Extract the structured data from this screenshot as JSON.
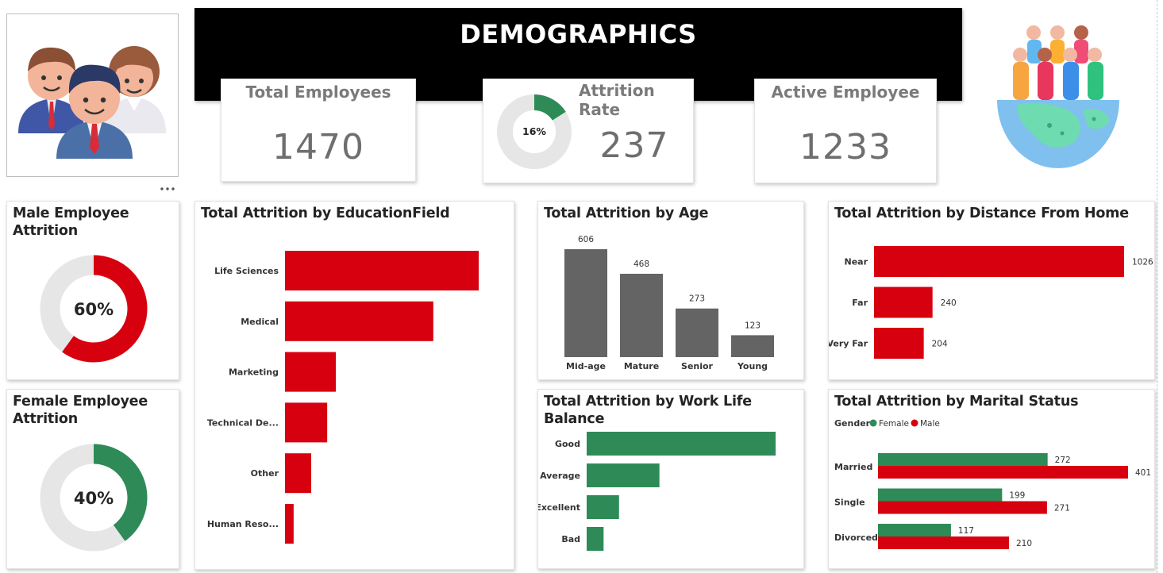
{
  "header": {
    "title": "DEMOGRAPHICS"
  },
  "icons": {
    "people_left": "employees-group-icon",
    "people_right": "world-people-icon",
    "more": "more-options-icon"
  },
  "colors": {
    "red": "#d7000f",
    "green": "#2e8b57",
    "gray": "#646464",
    "light": "#e6e6e6"
  },
  "kpis": {
    "total_employees": {
      "label": "Total Employees",
      "value": "1470"
    },
    "attrition_rate": {
      "label": "Attrition Rate",
      "value": "237",
      "donut_pct": 16,
      "donut_label": "16%"
    },
    "active_employee": {
      "label": "Active Employee",
      "value": "1233"
    }
  },
  "male_attrition": {
    "title": "Male Employee Attrition",
    "pct": 60,
    "label": "60%"
  },
  "female_attrition": {
    "title": "Female Employee Attrition",
    "pct": 40,
    "label": "40%"
  },
  "chart_data": [
    {
      "id": "education",
      "type": "bar",
      "orientation": "horizontal",
      "title": "Total Attrition by EducationField",
      "categories": [
        "Life Sciences",
        "Medical",
        "Marketing",
        "Technical De...",
        "Other",
        "Human Reso..."
      ],
      "values": [
        606,
        464,
        159,
        132,
        82,
        27
      ],
      "color": "#d7000f"
    },
    {
      "id": "age",
      "type": "bar",
      "orientation": "vertical",
      "title": "Total Attrition by Age",
      "categories": [
        "Mid-age",
        "Mature",
        "Senior",
        "Young"
      ],
      "values": [
        606,
        468,
        273,
        123
      ],
      "data_labels": [
        "606",
        "468",
        "273",
        "123"
      ],
      "color": "#646464"
    },
    {
      "id": "distance",
      "type": "bar",
      "orientation": "horizontal",
      "title": "Total Attrition by Distance From Home",
      "categories": [
        "Near",
        "Far",
        "Very Far"
      ],
      "values": [
        1026,
        240,
        204
      ],
      "data_labels": [
        "1026",
        "240",
        "204"
      ],
      "color": "#d7000f"
    },
    {
      "id": "worklife",
      "type": "bar",
      "orientation": "horizontal",
      "title": "Total Attrition by Work Life Balance",
      "categories": [
        "Good",
        "Average",
        "Excellent",
        "Bad"
      ],
      "values": [
        893,
        344,
        153,
        80
      ],
      "color": "#2e8b57"
    },
    {
      "id": "marital",
      "type": "bar",
      "orientation": "horizontal",
      "title": "Total Attrition by Marital Status",
      "legend_title": "Gender",
      "categories": [
        "Married",
        "Single",
        "Divorced"
      ],
      "series": [
        {
          "name": "Female",
          "values": [
            272,
            199,
            117
          ],
          "color": "#2e8b57"
        },
        {
          "name": "Male",
          "values": [
            401,
            271,
            210
          ],
          "color": "#d7000f"
        }
      ]
    }
  ]
}
